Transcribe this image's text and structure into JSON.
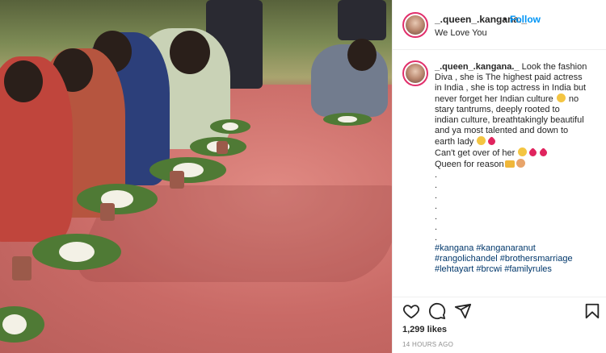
{
  "post": {
    "username": "_.queen_.kangana._",
    "dot": "•",
    "follow_label": "Follow",
    "subtitle": "We Love You"
  },
  "caption": {
    "username": "_.queen_.kangana._",
    "lines": [
      "Look the fashion",
      "Diva , she is The highest paid actress",
      "in India , she is top actress in India but",
      "never forget her Indian culture",
      "stary tantrums, deeply rooted to",
      "indian culture, breathtakingly beautiful",
      "and ya most talented and down to",
      "earth lady",
      "Can't get over of her",
      "Queen for reason"
    ],
    "line4_tail": "no",
    "dots": [
      ".",
      ".",
      ".",
      ".",
      ".",
      ".",
      "."
    ],
    "hashtags": [
      "#kangana #kanganaranut",
      "#rangolichandel #brothersmarriage",
      "#lehtayart #brcwi #familyrules"
    ]
  },
  "footer": {
    "likes": "1,299 likes",
    "time": "14 HOURS AGO"
  },
  "icons": {
    "like": "heart-icon",
    "comment": "comment-icon",
    "share": "share-icon",
    "save": "bookmark-icon"
  },
  "colors": {
    "accent": "#0095f6",
    "border": "#efefef",
    "text": "#262626",
    "muted": "#8e8e8e",
    "hashtag": "#00376b"
  }
}
